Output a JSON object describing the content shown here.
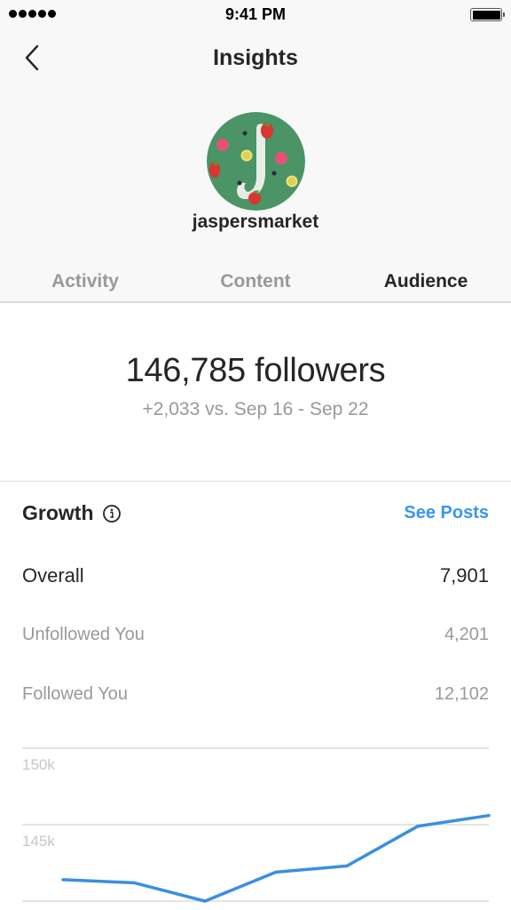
{
  "status_bar": {
    "time": "9:41 PM",
    "signal_dots": 5,
    "battery_level_percent": 100
  },
  "nav": {
    "title": "Insights",
    "back_icon": "chevron-left-icon"
  },
  "profile": {
    "username": "jaspersmarket",
    "avatar_icon": "avatar-image"
  },
  "tabs": [
    {
      "label": "Activity",
      "active": false
    },
    {
      "label": "Content",
      "active": false
    },
    {
      "label": "Audience",
      "active": true
    }
  ],
  "summary": {
    "followers": "146,785 followers",
    "delta": "+2,033 vs. Sep 16 - Sep 22"
  },
  "growth": {
    "title": "Growth",
    "info_icon": "info-icon",
    "see_posts_label": "See Posts",
    "rows": [
      {
        "label": "Overall",
        "value": "7,901"
      },
      {
        "label": "Unfollowed You",
        "value": "4,201"
      },
      {
        "label": "Followed You",
        "value": "12,102"
      }
    ]
  },
  "colors": {
    "accent": "#3897f0",
    "primary_text": "#262626",
    "secondary_text": "#999999",
    "line": "#3b8fe0",
    "gridline": "#dbdbdb"
  },
  "chart_data": {
    "type": "line",
    "title": "",
    "xlabel": "",
    "ylabel": "",
    "y_ticks": [
      {
        "value": 150000,
        "label": "150k"
      },
      {
        "value": 145000,
        "label": "145k"
      },
      {
        "value": 140000,
        "label": ""
      }
    ],
    "ylim": [
      140000,
      150000
    ],
    "grid": true,
    "legend": "none",
    "series": [
      {
        "name": "Followers",
        "values": [
          141400,
          141200,
          140000,
          141900,
          142300,
          144900,
          145600
        ]
      }
    ]
  }
}
